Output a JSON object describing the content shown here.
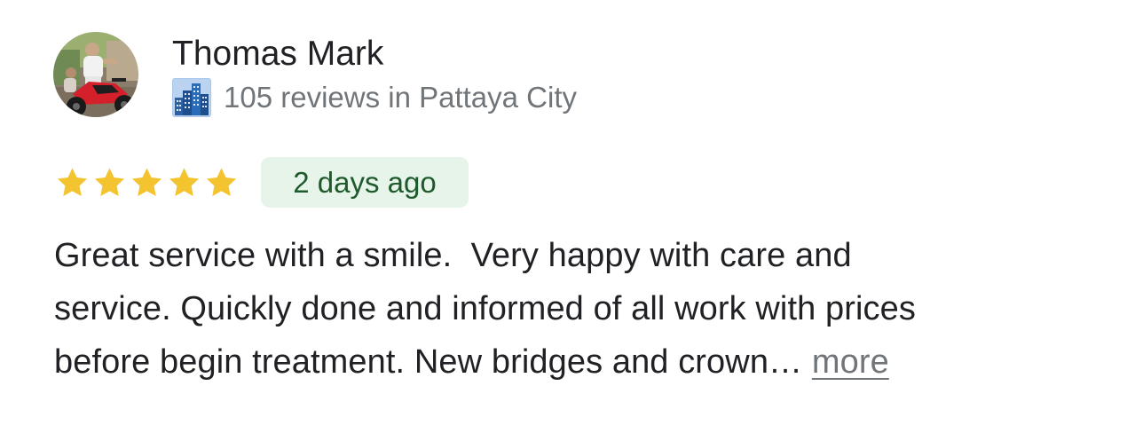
{
  "review": {
    "author": {
      "name": "Thomas Mark",
      "avatar_icon": "user-photo-motorcycle"
    },
    "reviewer_meta": {
      "icon": "city-buildings-icon",
      "text": "105 reviews in Pattaya City"
    },
    "rating": 5,
    "rating_max": 5,
    "star_color": "#f4c430",
    "date": "2 days ago",
    "date_badge_color": "#e6f4ea",
    "text_lines": [
      "Great service with a smile.  Very happy with care and",
      "service. Quickly done and informed of all work with prices",
      "before begin treatment. New bridges and crown… "
    ],
    "more_label": "more"
  }
}
